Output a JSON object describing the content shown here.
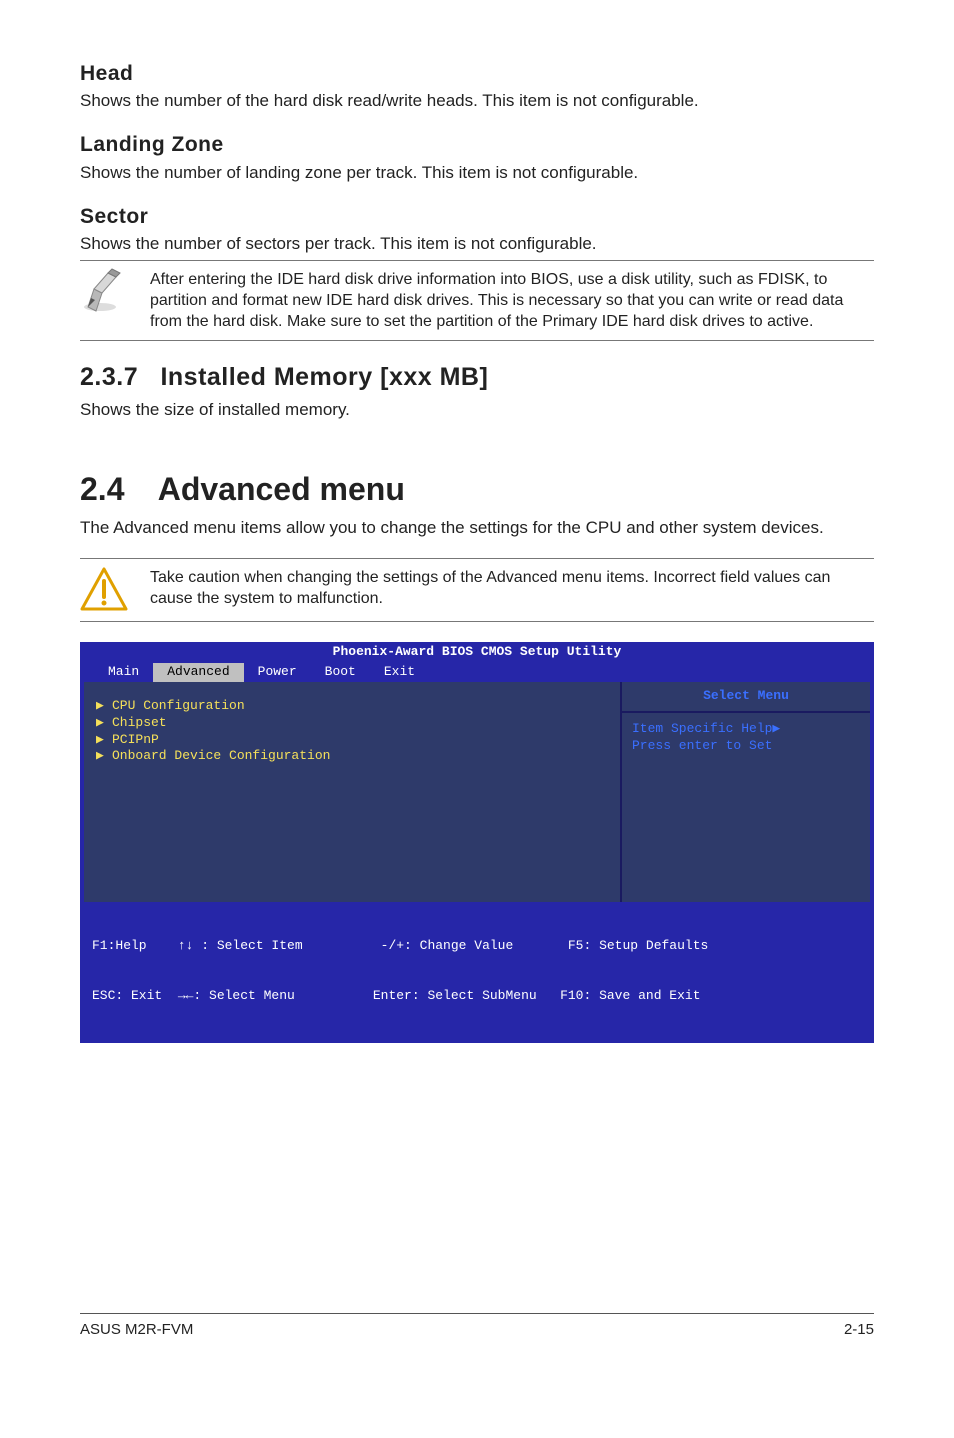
{
  "sections": {
    "head": {
      "title": "Head",
      "body": "Shows the number of the hard disk read/write heads. This item is not configurable."
    },
    "landing": {
      "title": "Landing Zone",
      "body": "Shows the number of landing zone per track. This item is not configurable."
    },
    "sector": {
      "title": "Sector",
      "body": "Shows the number of sectors per track. This item is not configurable."
    }
  },
  "note_pencil": "After entering the IDE hard disk drive information into BIOS, use a disk utility, such as FDISK, to partition and format new IDE hard disk drives. This is necessary so that you can write or read data from the hard disk. Make sure to set the partition of the Primary IDE hard disk drives to active.",
  "h2_installed": {
    "num": "2.3.7",
    "title": "Installed Memory [xxx MB]",
    "body": "Shows the size of installed memory."
  },
  "h1_advanced": {
    "num": "2.4",
    "title": "Advanced menu",
    "body": "The Advanced menu items allow you to change the settings for the CPU and other system devices."
  },
  "note_warn": "Take caution when changing the settings of the Advanced menu items. Incorrect field values can cause the system to malfunction.",
  "bios": {
    "title": "Phoenix-Award BIOS CMOS Setup Utility",
    "tabs": [
      "Main",
      "Advanced",
      "Power",
      "Boot",
      "Exit"
    ],
    "left_items": [
      "CPU Configuration",
      "Chipset",
      "PCIPnP",
      "Onboard Device Configuration"
    ],
    "right_title": "Select Menu",
    "right_lines": [
      "Item Specific Help▶",
      "",
      "Press enter to Set"
    ],
    "footer_l1": "F1:Help    ↑↓ : Select Item          -/+: Change Value       F5: Setup Defaults",
    "footer_l2": "ESC: Exit  →←: Select Menu          Enter: Select SubMenu   F10: Save and Exit"
  },
  "page_footer": {
    "left": "ASUS M2R-FVM",
    "right": "2-15"
  }
}
